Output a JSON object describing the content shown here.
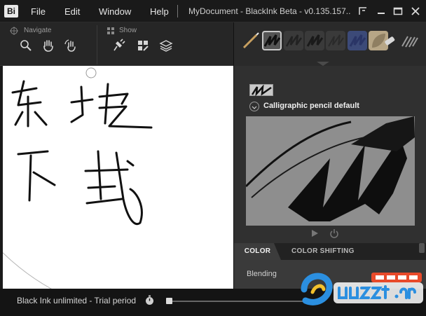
{
  "app": {
    "logo_text": "Bi",
    "document_title": "MyDocument - BlackInk Beta - v0.135.157..."
  },
  "menu": [
    {
      "label": "File"
    },
    {
      "label": "Edit"
    },
    {
      "label": "Window"
    },
    {
      "label": "Help"
    }
  ],
  "toolbar": {
    "navigate_label": "Navigate",
    "show_label": "Show",
    "navigate_tools": [
      "magnifier-icon",
      "hand-icon",
      "rotate-hand-icon"
    ],
    "show_tools": [
      "plug-icon",
      "layers-grid-icon",
      "layers-stack-icon"
    ]
  },
  "brushes": {
    "items": [
      "pen-nib",
      "calligraphic-pencil",
      "brush-3",
      "brush-4",
      "brush-5",
      "blue-brush",
      "leaf-brush",
      "eraser",
      "hatch-brush"
    ],
    "selected_index": 1
  },
  "panel": {
    "preset_name": "Calligraphic pencil default",
    "tabs": [
      {
        "label": "COLOR",
        "active": true
      },
      {
        "label": "COLOR SHIFTING",
        "active": false
      }
    ],
    "blending_label": "Blending"
  },
  "status": {
    "text": "Black Ink unlimited - Trial period"
  },
  "colors": {
    "background": "#1b1b1b",
    "canvas": "#ffffff",
    "panel": "#303030",
    "ink": "#111111"
  }
}
